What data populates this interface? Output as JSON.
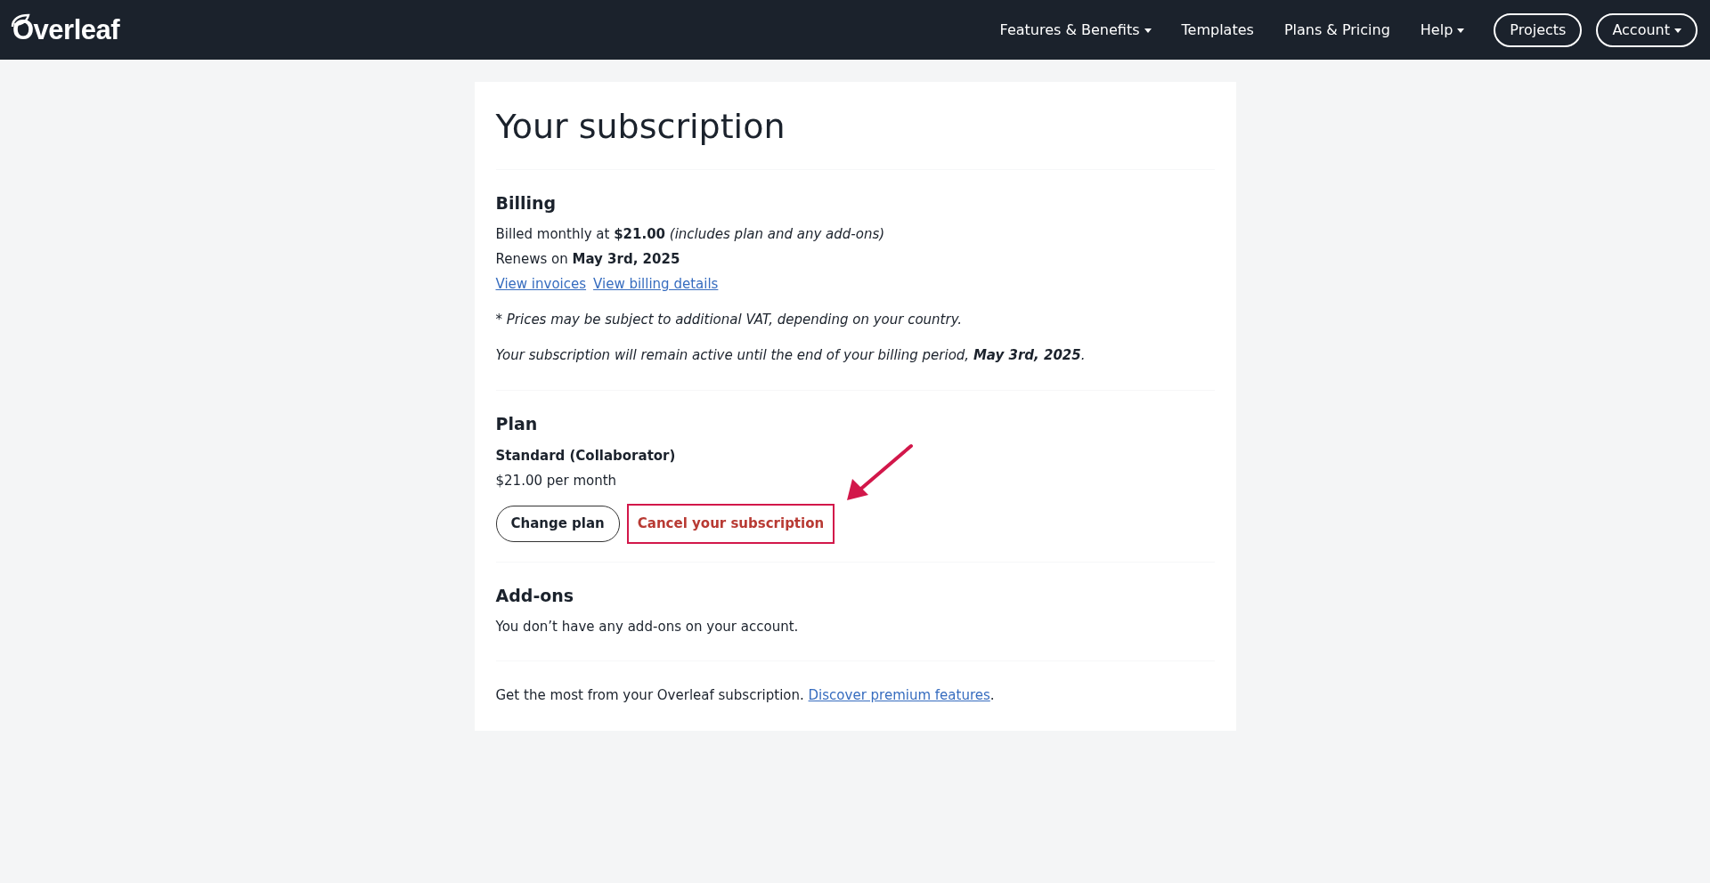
{
  "navbar": {
    "brand": "Overleaf",
    "items": [
      {
        "label": "Features & Benefits",
        "kind": "link",
        "dropdown": true
      },
      {
        "label": "Templates",
        "kind": "link",
        "dropdown": false
      },
      {
        "label": "Plans & Pricing",
        "kind": "link",
        "dropdown": false
      },
      {
        "label": "Help",
        "kind": "link",
        "dropdown": true
      },
      {
        "label": "Projects",
        "kind": "pill",
        "dropdown": false
      },
      {
        "label": "Account",
        "kind": "pill",
        "dropdown": true
      }
    ]
  },
  "title": "Your subscription",
  "billing": {
    "heading": "Billing",
    "lines": [
      "Billed monthly at **$21.00** *(includes plan and any add-ons)*",
      "Renews on **May 3rd, 2025**"
    ],
    "links": [
      "View invoices",
      "View billing details"
    ],
    "notes": [
      "* Prices may be subject to additional VAT, depending on your country.",
      "Your subscription will remain active until the end of your billing period, **May 3rd, 2025**."
    ]
  },
  "plan": {
    "heading": "Plan",
    "name": "Standard (Collaborator)",
    "price": "$21.00 per month",
    "buttons": [
      {
        "label": "Change plan",
        "kind": "outline",
        "highlighted": false
      },
      {
        "label": "Cancel your subscription",
        "kind": "danger-link",
        "highlighted": true
      }
    ]
  },
  "addons": {
    "heading": "Add-ons",
    "text": "You don’t have any add-ons on your account."
  },
  "footer": {
    "text": "Get the most from your Overleaf subscription.",
    "link": "Discover premium features",
    "suffix": "."
  }
}
